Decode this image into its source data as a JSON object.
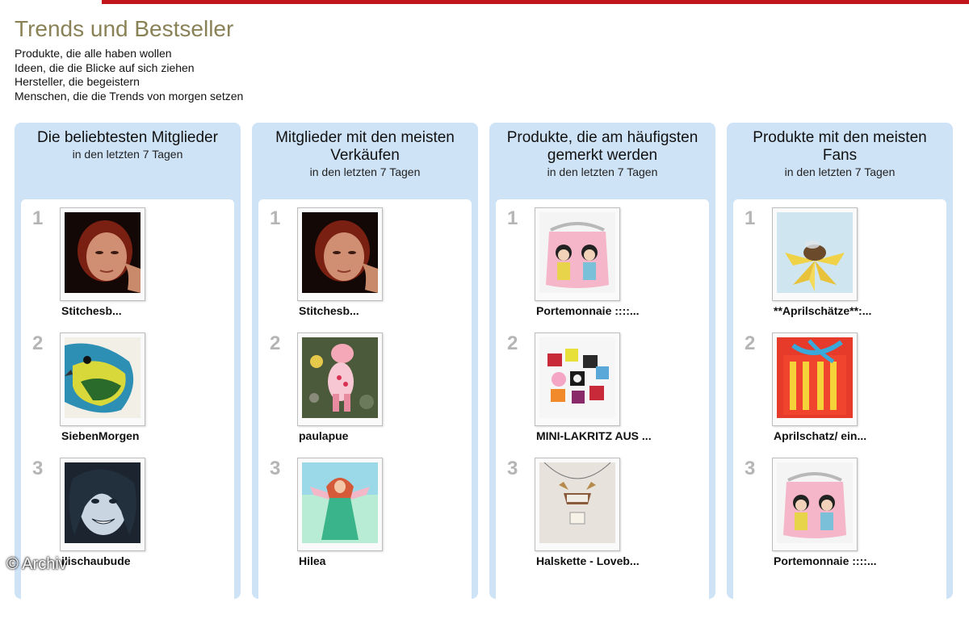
{
  "header": {
    "title": "Trends und Bestseller",
    "taglines": [
      "Produkte, die alle haben wollen",
      "Ideen, die die Blicke auf sich ziehen",
      "Hersteller, die begeistern",
      "Menschen, die die Trends von morgen setzen"
    ]
  },
  "columns": [
    {
      "title": "Die beliebtesten Mitglieder",
      "subtitle": "in den letzten 7 Tagen",
      "entries": [
        {
          "rank": "1",
          "label": "Stitchesb..."
        },
        {
          "rank": "2",
          "label": "SiebenMorgen"
        },
        {
          "rank": "3",
          "label": "ilischaubude"
        }
      ]
    },
    {
      "title": "Mitglieder mit den meisten Verkäufen",
      "subtitle": "in den letzten 7 Tagen",
      "entries": [
        {
          "rank": "1",
          "label": "Stitchesb..."
        },
        {
          "rank": "2",
          "label": "paulapue"
        },
        {
          "rank": "3",
          "label": "Hilea"
        }
      ]
    },
    {
      "title": "Produkte, die am häufigsten gemerkt werden",
      "subtitle": "in den letzten 7 Tagen",
      "entries": [
        {
          "rank": "1",
          "label": "Portemonnaie ::::..."
        },
        {
          "rank": "2",
          "label": "MINI-LAKRITZ AUS ..."
        },
        {
          "rank": "3",
          "label": "Halskette - Loveb..."
        }
      ]
    },
    {
      "title": "Produkte mit den meisten Fans",
      "subtitle": "in den letzten 7 Tagen",
      "entries": [
        {
          "rank": "1",
          "label": "**Aprilschätze**:..."
        },
        {
          "rank": "2",
          "label": "Aprilschatz/ ein..."
        },
        {
          "rank": "3",
          "label": "Portemonnaie ::::..."
        }
      ]
    }
  ],
  "watermark": "© Archiv",
  "colors": {
    "accent_bar": "#c2141b",
    "title": "#8a8257",
    "panel": "#cfe3f7"
  }
}
